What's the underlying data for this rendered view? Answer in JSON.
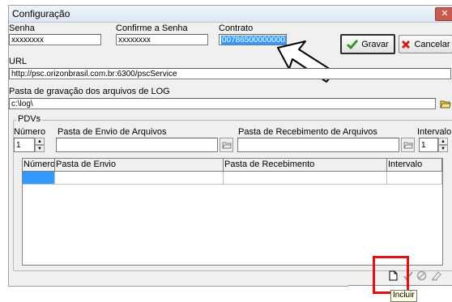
{
  "window": {
    "title": "Configuração",
    "close_glyph": "✕"
  },
  "labels": {
    "senha": "Senha",
    "confirme": "Confirme a Senha",
    "contrato": "Contrato",
    "url": "URL",
    "pasta_log": "Pasta de gravação dos arquivos de LOG"
  },
  "fields": {
    "senha_value": "xxxxxxxx",
    "confirme_value": "xxxxxxxx",
    "contrato_value": "007865000000001",
    "url_value": "http://psc.orizonbrasil.com.br:6300/pscService",
    "log_value": "c:\\log\\"
  },
  "buttons": {
    "gravar": "Gravar",
    "cancelar": "Cancelar"
  },
  "pdvs": {
    "group_label": "PDVs",
    "numero_label": "Número",
    "pasta_envio_label": "Pasta de Envio de Arquivos",
    "pasta_receb_label": "Pasta de Recebimento de Arquivos",
    "intervalo_label": "Intervalo",
    "numero_value": "1",
    "intervalo_value": "1",
    "columns": [
      "Número",
      "Pasta de Envio",
      "Pasta de Recebimento",
      "Intervalo"
    ]
  },
  "tooltip": "Incluir",
  "colors": {
    "selection": "#3399ff",
    "highlight_box": "#e01010",
    "grid_active_cell": "#3399ff"
  }
}
